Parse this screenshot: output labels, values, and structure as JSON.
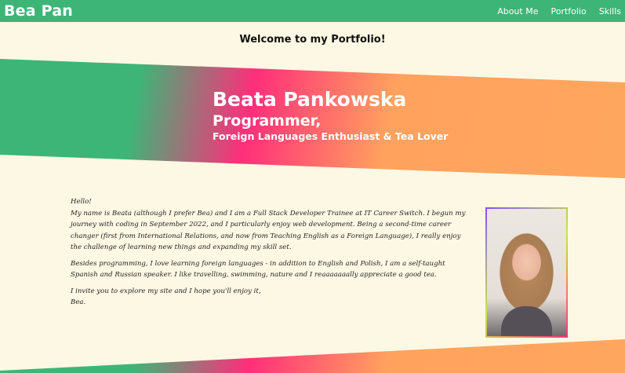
{
  "nav": {
    "brand": "Bea Pan",
    "links": [
      "About Me",
      "Portfolio",
      "Skills"
    ]
  },
  "welcome": "Welcome to my Portfolio!",
  "hero": {
    "name": "Beata Pankowska",
    "title": "Programmer,",
    "subtitle": "Foreign Languages Enthusiast & Tea Lover"
  },
  "about": {
    "greeting": "Hello!",
    "p1": "My name is Beata (although I prefer Bea) and I am a Full Stack Developer Trainee at IT Career Switch. I begun my journey with coding in September 2022, and I particularly enjoy web development. Being a second-time career changer (first from International Relations, and now from Teaching English as a Foreign Language), I really enjoy the challenge of learning new things and expanding my skill set.",
    "p2": "Besides programming, I love learning foreign languages - in addition to English and Polish, I am a self-taught Spanish and Russian speaker. I like travelling, swimming, nature and I reaaaaaaally appreciate a good tea.",
    "p3": "I invite you to explore my site and I hope you'll enjoy it,",
    "signoff": "Bea."
  },
  "colors": {
    "nav_green": "#3db577",
    "pink": "#ff2e7a",
    "orange": "#ffa25e",
    "background": "#fdf8e3"
  }
}
